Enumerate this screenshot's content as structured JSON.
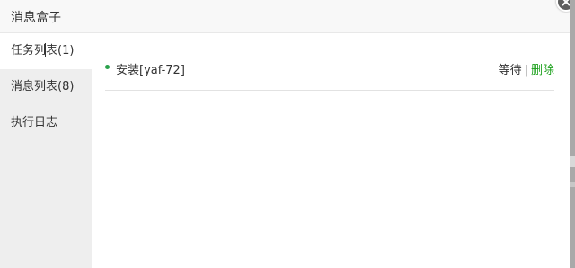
{
  "dialog": {
    "title": "消息盒子"
  },
  "sidebar": {
    "tabs": [
      {
        "label": "任务列",
        "label_after_caret": "表(1)",
        "active": true
      },
      {
        "label": "消息列表(8)",
        "active": false
      },
      {
        "label": "执行日志",
        "active": false
      }
    ]
  },
  "tasks": [
    {
      "bullet_color": "#2aa14b",
      "name": "安装[yaf-72]",
      "status": "等待",
      "separator": "|",
      "delete_label": "删除"
    }
  ],
  "icons": {
    "close": "close-icon"
  },
  "colors": {
    "accent_green": "#1aa01a",
    "sidebar_bg": "#eeeeee",
    "titlebar_bg": "#f8f8f8"
  }
}
